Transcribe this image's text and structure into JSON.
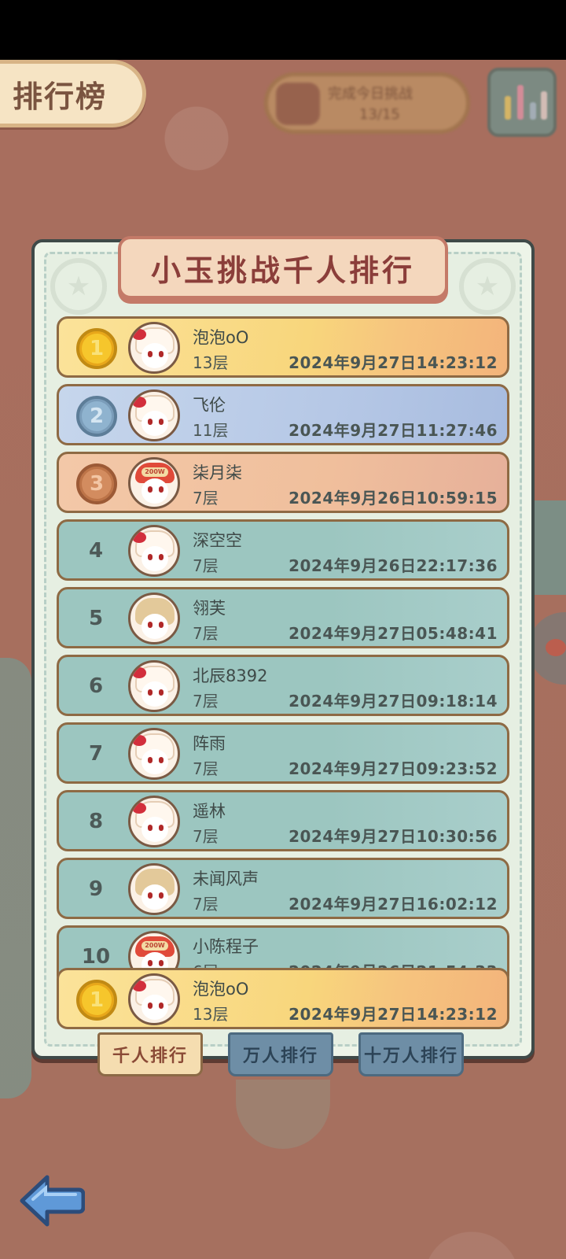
{
  "header": {
    "title": "排行榜"
  },
  "top_bar": {
    "challenge_text": "完成今日挑战",
    "challenge_count": "13/15"
  },
  "panel": {
    "title": "小玉挑战千人排行"
  },
  "leaderboard": [
    {
      "rank": "1",
      "medal": "gold",
      "avatar": "girl",
      "name": "泡泡oO",
      "floor": "13层",
      "time": "2024年9月27日14:23:12"
    },
    {
      "rank": "2",
      "medal": "silver",
      "avatar": "girl",
      "name": "飞伦",
      "floor": "11层",
      "time": "2024年9月27日11:27:46"
    },
    {
      "rank": "3",
      "medal": "bronze",
      "avatar": "cap",
      "name": "柒月柒",
      "floor": "7层",
      "time": "2024年9月26日10:59:15"
    },
    {
      "rank": "4",
      "medal": "",
      "avatar": "girl",
      "name": "深空空",
      "floor": "7层",
      "time": "2024年9月26日22:17:36"
    },
    {
      "rank": "5",
      "medal": "",
      "avatar": "boy",
      "name": "翎芙",
      "floor": "7层",
      "time": "2024年9月27日05:48:41"
    },
    {
      "rank": "6",
      "medal": "",
      "avatar": "girl",
      "name": "北辰8392",
      "floor": "7层",
      "time": "2024年9月27日09:18:14"
    },
    {
      "rank": "7",
      "medal": "",
      "avatar": "girl",
      "name": "阵雨",
      "floor": "7层",
      "time": "2024年9月27日09:23:52"
    },
    {
      "rank": "8",
      "medal": "",
      "avatar": "girl",
      "name": "遥林",
      "floor": "7层",
      "time": "2024年9月27日10:30:56"
    },
    {
      "rank": "9",
      "medal": "",
      "avatar": "boy",
      "name": "未闻风声",
      "floor": "7层",
      "time": "2024年9月27日16:02:12"
    },
    {
      "rank": "10",
      "medal": "",
      "avatar": "cap",
      "name": "小陈程子",
      "floor": "6层",
      "time": "2024年9月26日21:54:33"
    }
  ],
  "my_entry": {
    "rank": "1",
    "medal": "gold",
    "avatar": "girl",
    "name": "泡泡oO",
    "floor": "13层",
    "time": "2024年9月27日14:23:12"
  },
  "tabs": [
    {
      "label": "千人排行",
      "active": true
    },
    {
      "label": "万人排行",
      "active": false
    },
    {
      "label": "十万人排行",
      "active": false
    }
  ],
  "colors": {
    "gold": "#f6c62c",
    "silver": "#8fb3cf",
    "bronze": "#d38c5f",
    "row_default": "#9cc6c0"
  },
  "icons": {
    "back": "left-arrow-icon",
    "stats": "bar-chart-icon"
  }
}
